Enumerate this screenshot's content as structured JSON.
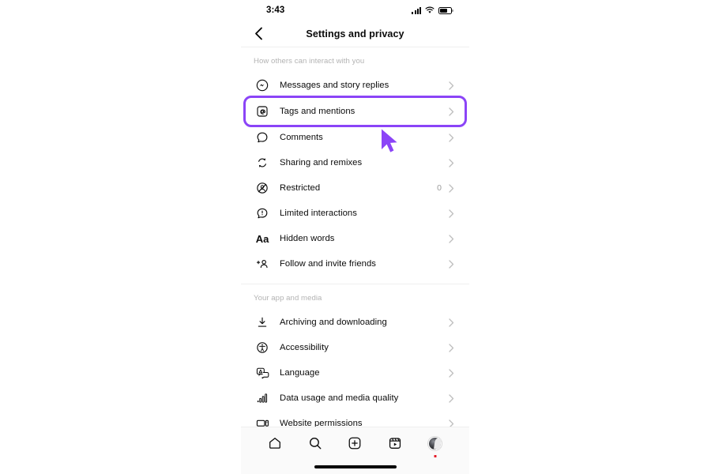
{
  "status_bar": {
    "time": "3:43",
    "signal_icon": "cellular-signal-icon",
    "wifi_icon": "wifi-icon",
    "battery_icon": "battery-icon"
  },
  "header": {
    "title": "Settings and privacy",
    "back_icon": "chevron-left-icon"
  },
  "accent_color": "#8b44f7",
  "sections": [
    {
      "label": "How others can interact with you",
      "items": [
        {
          "icon": "messenger-icon",
          "label": "Messages and story replies",
          "count": ""
        },
        {
          "icon": "at-mention-icon",
          "label": "Tags and mentions",
          "count": "",
          "highlighted": true
        },
        {
          "icon": "comment-icon",
          "label": "Comments",
          "count": ""
        },
        {
          "icon": "remix-icon",
          "label": "Sharing and remixes",
          "count": ""
        },
        {
          "icon": "restricted-icon",
          "label": "Restricted",
          "count": "0"
        },
        {
          "icon": "limited-icon",
          "label": "Limited interactions",
          "count": ""
        },
        {
          "icon": "hidden-words-icon",
          "label": "Hidden words",
          "count": ""
        },
        {
          "icon": "add-person-icon",
          "label": "Follow and invite friends",
          "count": ""
        }
      ]
    },
    {
      "label": "Your app and media",
      "items": [
        {
          "icon": "download-icon",
          "label": "Archiving and downloading",
          "count": ""
        },
        {
          "icon": "accessibility-icon",
          "label": "Accessibility",
          "count": ""
        },
        {
          "icon": "language-icon",
          "label": "Language",
          "count": ""
        },
        {
          "icon": "data-usage-icon",
          "label": "Data usage and media quality",
          "count": ""
        },
        {
          "icon": "website-icon",
          "label": "Website permissions",
          "count": ""
        }
      ]
    }
  ],
  "bottom_nav": [
    {
      "icon": "home-icon",
      "name": "nav-home"
    },
    {
      "icon": "search-icon",
      "name": "nav-search"
    },
    {
      "icon": "add-icon",
      "name": "nav-create"
    },
    {
      "icon": "reels-icon",
      "name": "nav-reels"
    },
    {
      "icon": "avatar-icon",
      "name": "nav-profile"
    }
  ],
  "cursor": {
    "icon": "mouse-pointer-icon",
    "color": "#8b44f7"
  }
}
